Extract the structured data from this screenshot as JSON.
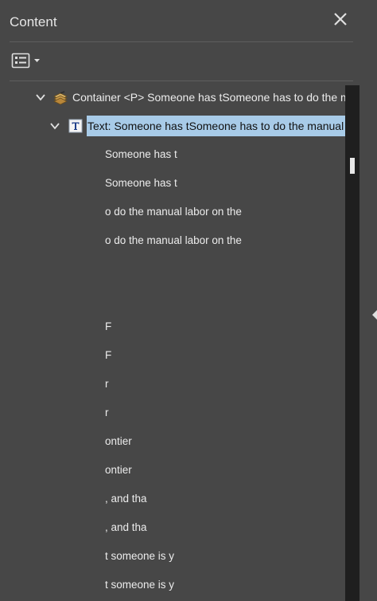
{
  "panel": {
    "title": "Content",
    "close_icon": "close-icon",
    "options_icon": "list-options-icon"
  },
  "tree": {
    "container": {
      "icon": "container-tag-icon",
      "label": "Container <P> Someone has tSomeone has to do the manual labor on the"
    },
    "text_node": {
      "icon": "text-object-icon",
      "label": "Text: Someone has tSomeone has to do the manual labor on the"
    },
    "lines": [
      "Someone has t",
      "Someone has t",
      "o do the manual labor on the",
      "o do the manual labor on the",
      "",
      "",
      "F",
      "F",
      "r",
      "r",
      "ontier",
      "ontier",
      ", and tha",
      ", and tha",
      "t someone is y",
      "t someone is y"
    ]
  },
  "colors": {
    "background": "#474747",
    "selection": "#a8cbe8",
    "scrollbar_track": "#1f1f1f"
  }
}
